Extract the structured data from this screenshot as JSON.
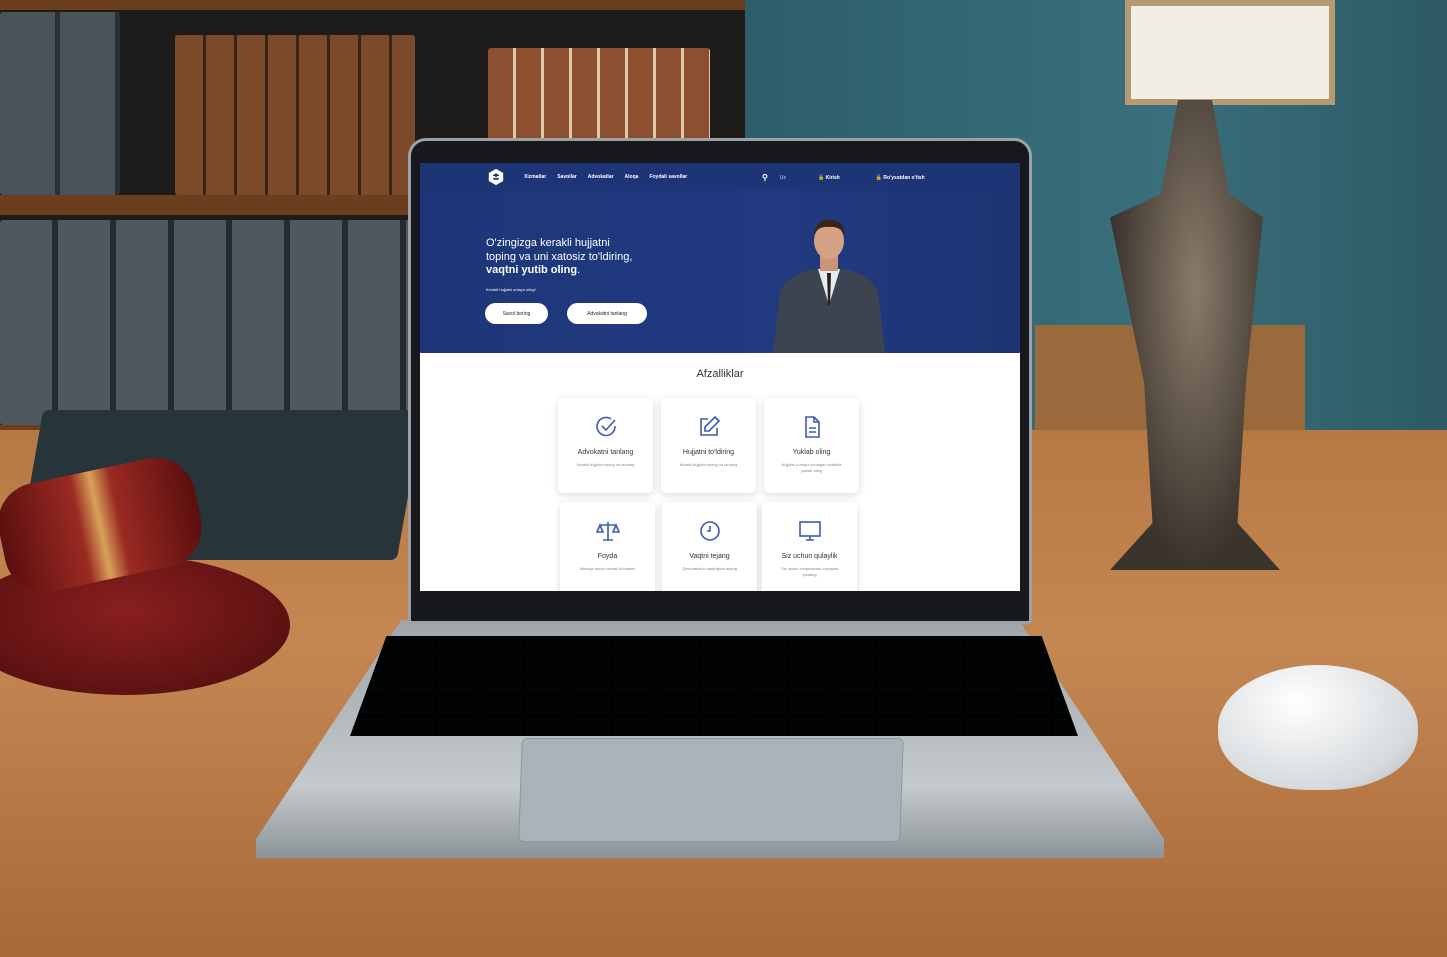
{
  "nav": {
    "links": [
      "Xizmatlar",
      "Savollar",
      "Advokatlar",
      "Aloqa",
      "Foydali savollar"
    ],
    "language": "Uz",
    "login": "Kirish",
    "register": "Ro'yxatdan o'tish"
  },
  "hero": {
    "title_line1": "O'zingizga kerakli hujjatni",
    "title_line2": "toping va uni xatosiz to'ldiring,",
    "title_bold": "vaqtni yutib oling",
    "subtitle": "Kerakli hujjatni onlayn oling!",
    "button_ask": "Savol bering",
    "button_lawyer": "Advokatni tanlang"
  },
  "advantages": {
    "title": "Afzalliklar",
    "cards": [
      {
        "icon": "check-circle-icon",
        "title": "Advokatni tanlang",
        "desc": "Kerakli hujjatni toping va tanlang"
      },
      {
        "icon": "edit-icon",
        "title": "Hujjatni to'ldiring",
        "desc": "Kerakli hujjatni toping va tanlang"
      },
      {
        "icon": "document-icon",
        "title": "Yuklab oling",
        "desc": "Hujjatni o'zingiz xohlagan shaklda yuklab oling"
      },
      {
        "icon": "scales-icon",
        "title": "Foyda",
        "desc": "Mutlaqo bepul xizmat ko'rsatish"
      },
      {
        "icon": "clock-icon",
        "title": "Vaqtni tejang",
        "desc": "Qimmatbaho vaqtingizni tejang"
      },
      {
        "icon": "monitor-icon",
        "title": "Siz uchun qulaylik",
        "desc": "Siz uydan chiqmasdan murojaat yarating"
      }
    ]
  },
  "colors": {
    "brand": "#1d3577",
    "icon": "#3b5bb5"
  }
}
